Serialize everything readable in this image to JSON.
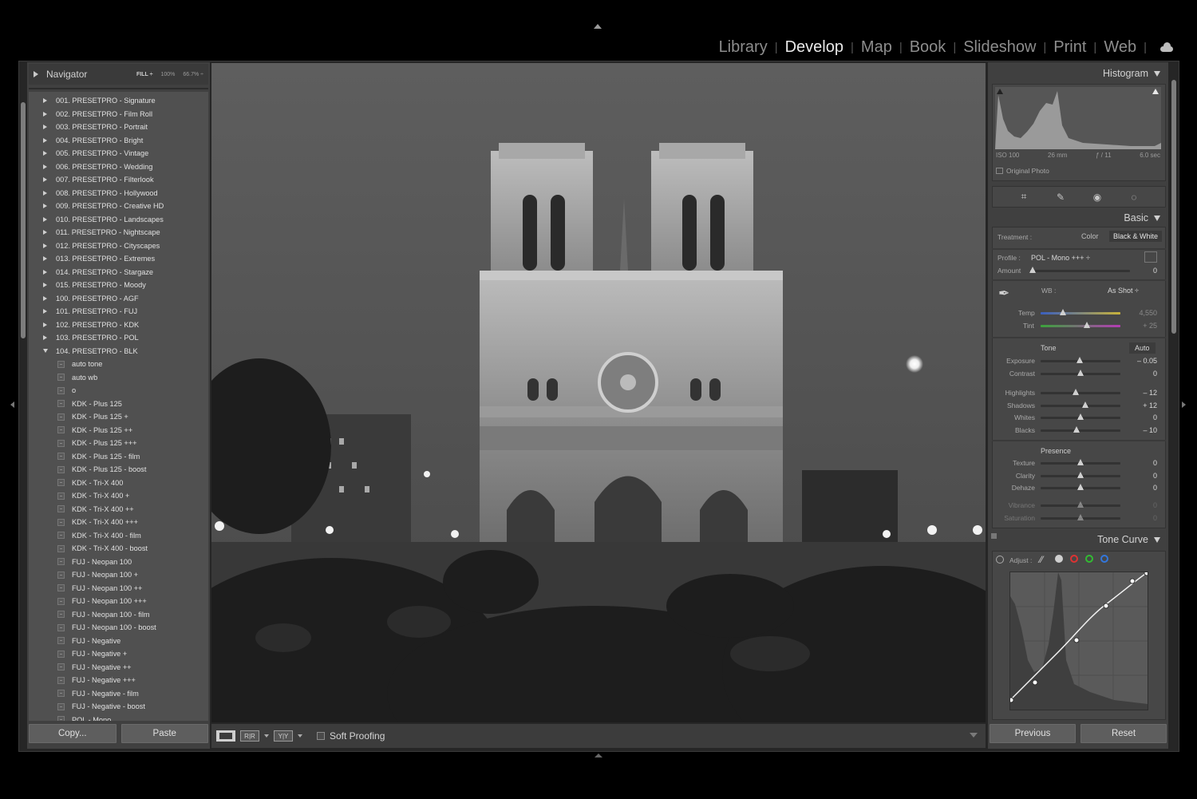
{
  "modules": [
    {
      "label": "Library",
      "active": false
    },
    {
      "label": "Develop",
      "active": true
    },
    {
      "label": "Map",
      "active": false
    },
    {
      "label": "Book",
      "active": false
    },
    {
      "label": "Slideshow",
      "active": false
    },
    {
      "label": "Print",
      "active": false
    },
    {
      "label": "Web",
      "active": false
    }
  ],
  "module_separator": "|",
  "navigator": {
    "title": "Navigator",
    "zoom_options": [
      "FILL ÷",
      "100%",
      "66.7% ÷"
    ]
  },
  "presets": [
    {
      "label": "001. PRESETPRO - Signature",
      "kind": "folder"
    },
    {
      "label": "002. PRESETPRO - Film Roll",
      "kind": "folder"
    },
    {
      "label": "003. PRESETPRO - Portrait",
      "kind": "folder"
    },
    {
      "label": "004. PRESETPRO - Bright",
      "kind": "folder"
    },
    {
      "label": "005. PRESETPRO - Vintage",
      "kind": "folder"
    },
    {
      "label": "006. PRESETPRO - Wedding",
      "kind": "folder"
    },
    {
      "label": "007. PRESETPRO - Filterlook",
      "kind": "folder"
    },
    {
      "label": "008. PRESETPRO - Hollywood",
      "kind": "folder"
    },
    {
      "label": "009. PRESETPRO - Creative HD",
      "kind": "folder"
    },
    {
      "label": "010. PRESETPRO - Landscapes",
      "kind": "folder"
    },
    {
      "label": "011. PRESETPRO - Nightscape",
      "kind": "folder"
    },
    {
      "label": "012. PRESETPRO - Cityscapes",
      "kind": "folder"
    },
    {
      "label": "013. PRESETPRO - Extremes",
      "kind": "folder"
    },
    {
      "label": "014. PRESETPRO - Stargaze",
      "kind": "folder"
    },
    {
      "label": "015. PRESETPRO - Moody",
      "kind": "folder"
    },
    {
      "label": "100. PRESETPRO - AGF",
      "kind": "folder"
    },
    {
      "label": "101. PRESETPRO - FUJ",
      "kind": "folder"
    },
    {
      "label": "102. PRESETPRO - KDK",
      "kind": "folder"
    },
    {
      "label": "103. PRESETPRO - POL",
      "kind": "folder"
    },
    {
      "label": "104. PRESETPRO - BLK",
      "kind": "folder-open"
    },
    {
      "label": "auto tone",
      "kind": "preset"
    },
    {
      "label": "auto wb",
      "kind": "preset"
    },
    {
      "label": "o",
      "kind": "preset"
    },
    {
      "label": "KDK - Plus 125",
      "kind": "preset"
    },
    {
      "label": "KDK - Plus 125 +",
      "kind": "preset"
    },
    {
      "label": "KDK - Plus 125 ++",
      "kind": "preset"
    },
    {
      "label": "KDK - Plus 125 +++",
      "kind": "preset"
    },
    {
      "label": "KDK - Plus 125 - film",
      "kind": "preset"
    },
    {
      "label": "KDK - Plus 125 - boost",
      "kind": "preset"
    },
    {
      "label": "KDK - Tri-X 400",
      "kind": "preset"
    },
    {
      "label": "KDK - Tri-X 400 +",
      "kind": "preset"
    },
    {
      "label": "KDK - Tri-X 400 ++",
      "kind": "preset"
    },
    {
      "label": "KDK - Tri-X 400 +++",
      "kind": "preset"
    },
    {
      "label": "KDK - Tri-X 400 - film",
      "kind": "preset"
    },
    {
      "label": "KDK - Tri-X 400 - boost",
      "kind": "preset"
    },
    {
      "label": "FUJ - Neopan 100",
      "kind": "preset"
    },
    {
      "label": "FUJ - Neopan 100 +",
      "kind": "preset"
    },
    {
      "label": "FUJ - Neopan 100 ++",
      "kind": "preset"
    },
    {
      "label": "FUJ - Neopan 100 +++",
      "kind": "preset"
    },
    {
      "label": "FUJ - Neopan 100 - film",
      "kind": "preset"
    },
    {
      "label": "FUJ - Neopan 100 - boost",
      "kind": "preset"
    },
    {
      "label": "FUJ - Negative",
      "kind": "preset"
    },
    {
      "label": "FUJ - Negative +",
      "kind": "preset"
    },
    {
      "label": "FUJ - Negative ++",
      "kind": "preset"
    },
    {
      "label": "FUJ - Negative +++",
      "kind": "preset"
    },
    {
      "label": "FUJ - Negative - film",
      "kind": "preset"
    },
    {
      "label": "FUJ - Negative - boost",
      "kind": "preset"
    },
    {
      "label": "POL - Mono",
      "kind": "preset"
    }
  ],
  "left_buttons": {
    "copy": "Copy...",
    "paste": "Paste"
  },
  "toolbar": {
    "view1": "",
    "view2": "R|R",
    "view3": "Y|Y",
    "soft_proofing": "Soft Proofing"
  },
  "histogram": {
    "title": "Histogram",
    "iso": "ISO 100",
    "focal": "26 mm",
    "aperture": "ƒ / 11",
    "shutter": "6.0 sec",
    "original_photo": "Original Photo"
  },
  "basic": {
    "title": "Basic",
    "treatment_label": "Treatment :",
    "treatment_color": "Color",
    "treatment_bw": "Black & White",
    "profile_label": "Profile :",
    "profile_value": "POL - Mono +++ ÷",
    "amount_label": "Amount",
    "amount_value": "0",
    "wb_label": "WB :",
    "wb_value": "As Shot ÷",
    "temp_label": "Temp",
    "temp_value": "4,550",
    "tint_label": "Tint",
    "tint_value": "+ 25",
    "tone_label": "Tone",
    "auto_label": "Auto",
    "sliders": [
      {
        "label": "Exposure",
        "value": "– 0.05",
        "pos": 0.49
      },
      {
        "label": "Contrast",
        "value": "0",
        "pos": 0.5
      },
      {
        "label": "Highlights",
        "value": "– 12",
        "pos": 0.44
      },
      {
        "label": "Shadows",
        "value": "+ 12",
        "pos": 0.56
      },
      {
        "label": "Whites",
        "value": "0",
        "pos": 0.5
      },
      {
        "label": "Blacks",
        "value": "– 10",
        "pos": 0.45
      }
    ],
    "presence_label": "Presence",
    "presence_sliders": [
      {
        "label": "Texture",
        "value": "0",
        "pos": 0.5
      },
      {
        "label": "Clarity",
        "value": "0",
        "pos": 0.5
      },
      {
        "label": "Dehaze",
        "value": "0",
        "pos": 0.5
      },
      {
        "label": "Vibrance",
        "value": "0",
        "pos": 0.5
      },
      {
        "label": "Saturation",
        "value": "0",
        "pos": 0.5
      }
    ],
    "amount_pos": 0.0,
    "temp_pos": 0.28,
    "tint_pos": 0.58
  },
  "tone_curve": {
    "title": "Tone Curve",
    "adjust_label": "Adjust :",
    "channel_colors": [
      "#cfcfcf",
      "#d33",
      "#3b3",
      "#37d"
    ]
  },
  "right_buttons": {
    "previous": "Previous",
    "reset": "Reset"
  }
}
